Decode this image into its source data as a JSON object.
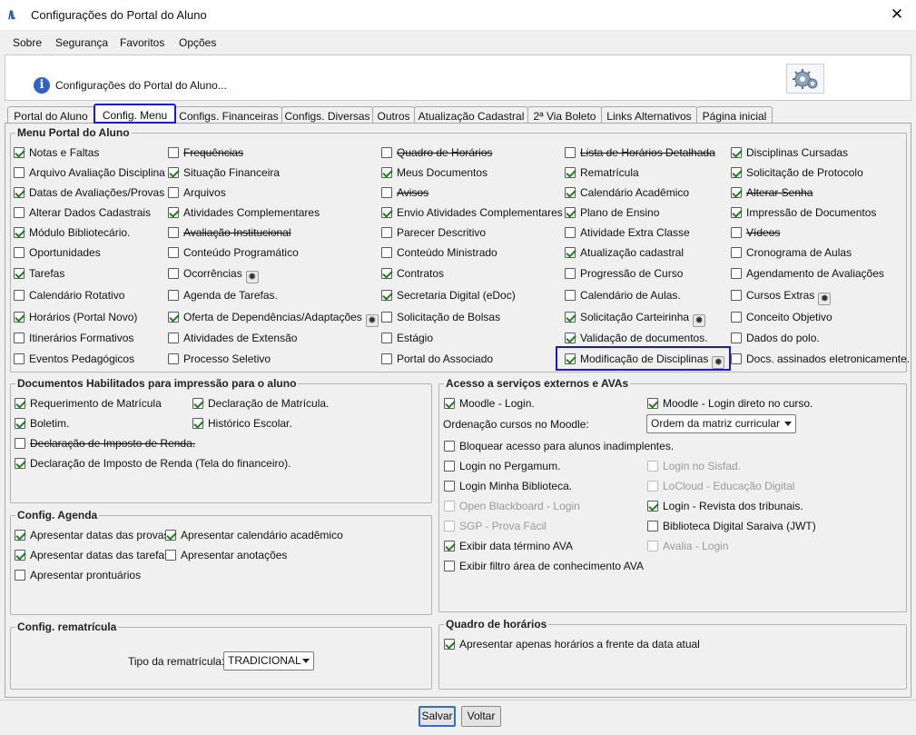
{
  "window": {
    "logo": "/\\\\.",
    "title": "Configurações do Portal do Aluno",
    "close": "✕"
  },
  "menubar": {
    "sobre": "Sobre",
    "seguranca": "Segurança",
    "favoritos": "Favoritos",
    "opcoes": "Opções"
  },
  "header": {
    "info_icon": "i",
    "text": "Configurações do Portal do Aluno...",
    "settings_icon": "gears-icon"
  },
  "tabs": [
    "Portal do Aluno",
    "Config. Menu",
    "Configs. Financeiras",
    "Configs. Diversas",
    "Outros",
    "Atualização Cadastral",
    "2ª Via Boleto",
    "Links Alternativos",
    "Página inicial"
  ],
  "active_tab": "Config. Menu",
  "menu_portal": {
    "title": "Menu Portal do Aluno",
    "columns": [
      [
        {
          "label": "Notas e Faltas",
          "checked": true
        },
        {
          "label": "Arquivo Avaliação Disciplina",
          "checked": false
        },
        {
          "label": "Datas de Avaliações/Provas",
          "checked": true
        },
        {
          "label": "Alterar Dados Cadastrais",
          "checked": false
        },
        {
          "label": "Módulo Bibliotecário.",
          "checked": true
        },
        {
          "label": "Oportunidades",
          "checked": false
        },
        {
          "label": "Tarefas",
          "checked": true
        },
        {
          "label": "Calendário Rotativo",
          "checked": false
        },
        {
          "label": "Horários (Portal Novo)",
          "checked": true
        },
        {
          "label": "Itinerários Formativos",
          "checked": false
        },
        {
          "label": "Eventos Pedagógicos",
          "checked": false
        }
      ],
      [
        {
          "label": "Frequências",
          "checked": false,
          "strike": true
        },
        {
          "label": "Situação Financeira",
          "checked": true
        },
        {
          "label": "Arquivos",
          "checked": false
        },
        {
          "label": "Atividades Complementares",
          "checked": true
        },
        {
          "label": "Avaliação Institucional",
          "checked": false,
          "strike": true
        },
        {
          "label": "Conteúdo Programático",
          "checked": false
        },
        {
          "label": "Ocorrências",
          "checked": false,
          "gear": true
        },
        {
          "label": "Agenda de Tarefas.",
          "checked": false
        },
        {
          "label": "Oferta de Dependências/Adaptações",
          "checked": true,
          "gear": true
        },
        {
          "label": "Atividades de Extensão",
          "checked": false
        },
        {
          "label": "Processo Seletivo",
          "checked": false
        }
      ],
      [
        {
          "label": "Quadro de Horários",
          "checked": false,
          "strike": true
        },
        {
          "label": "Meus Documentos",
          "checked": true
        },
        {
          "label": "Avisos",
          "checked": false,
          "strike": true
        },
        {
          "label": "Envio Atividades Complementares",
          "checked": true
        },
        {
          "label": "Parecer Descritivo",
          "checked": false
        },
        {
          "label": "Conteúdo Ministrado",
          "checked": false
        },
        {
          "label": "Contratos",
          "checked": true
        },
        {
          "label": "Secretaria Digital (eDoc)",
          "checked": true
        },
        {
          "label": "Solicitação de Bolsas",
          "checked": false
        },
        {
          "label": "Estágio",
          "checked": false
        },
        {
          "label": "Portal do Associado",
          "checked": false
        }
      ],
      [
        {
          "label": "Lista de Horários Detalhada",
          "checked": false,
          "strike": true
        },
        {
          "label": "Rematrícula",
          "checked": true
        },
        {
          "label": "Calendário Acadêmico",
          "checked": true
        },
        {
          "label": "Plano de Ensino",
          "checked": true
        },
        {
          "label": "Atividade Extra Classe",
          "checked": false
        },
        {
          "label": "Atualização cadastral",
          "checked": true
        },
        {
          "label": "Progressão de Curso",
          "checked": false
        },
        {
          "label": "Calendário de Aulas.",
          "checked": false
        },
        {
          "label": "Solicitação Carteirinha",
          "checked": true,
          "gear": true
        },
        {
          "label": "Validação de documentos.",
          "checked": true
        },
        {
          "label": "Modificação de Disciplinas",
          "checked": true,
          "gear": true
        }
      ],
      [
        {
          "label": "Disciplinas Cursadas",
          "checked": true
        },
        {
          "label": "Solicitação de Protocolo",
          "checked": true
        },
        {
          "label": "Alterar Senha",
          "checked": true,
          "strike": true
        },
        {
          "label": "Impressão de Documentos",
          "checked": true
        },
        {
          "label": "Vídeos",
          "checked": false,
          "strike": true
        },
        {
          "label": "Cronograma de Aulas",
          "checked": false
        },
        {
          "label": "Agendamento de Avaliações",
          "checked": false
        },
        {
          "label": "Cursos Extras",
          "checked": false,
          "gear": true
        },
        {
          "label": "Conceito Objetivo",
          "checked": false
        },
        {
          "label": "Dados do polo.",
          "checked": false
        },
        {
          "label": "Docs. assinados eletronicamente.",
          "checked": false
        }
      ]
    ]
  },
  "docs": {
    "title": "Documentos Habilitados para impressão para o aluno",
    "items": [
      {
        "label": "Requerimento de Matrícula",
        "checked": true
      },
      {
        "label": "Declaração de Matrícula.",
        "checked": true
      },
      {
        "label": "Boletim.",
        "checked": true
      },
      {
        "label": "Histórico Escolar.",
        "checked": true
      },
      {
        "label": "Declaração de Imposto de Renda.",
        "checked": false,
        "strike": true
      },
      {
        "label": "Declaração de Imposto de Renda (Tela do financeiro).",
        "checked": true
      }
    ]
  },
  "agenda": {
    "title": "Config. Agenda",
    "items": [
      {
        "label": "Apresentar datas das provas",
        "checked": true
      },
      {
        "label": "Apresentar calendário acadêmico",
        "checked": true
      },
      {
        "label": "Apresentar datas das tarefas",
        "checked": true
      },
      {
        "label": "Apresentar anotações",
        "checked": false
      },
      {
        "label": "Apresentar prontuários",
        "checked": false
      }
    ]
  },
  "rematricula": {
    "title": "Config. rematrícula",
    "label": "Tipo da rematrícula:",
    "value": "TRADICIONAL"
  },
  "ava": {
    "title": "Acesso a serviços externos e AVAs",
    "moodle_login": {
      "label": "Moodle - Login.",
      "checked": true
    },
    "moodle_direct": {
      "label": "Moodle - Login direto no curso.",
      "checked": true
    },
    "ordenacao_label": "Ordenação cursos no Moodle:",
    "ordenacao_value": "Ordem da matriz curricular",
    "items": [
      {
        "label": "Bloquear acesso para alunos inadimplentes.",
        "checked": false
      },
      {
        "label": "Login no Pergamum.",
        "checked": false
      },
      {
        "label": "Login no Sisfad.",
        "checked": false,
        "disabled": true
      },
      {
        "label": "Login Minha Biblioteca.",
        "checked": false
      },
      {
        "label": "LoCloud - Educação Digital",
        "checked": false,
        "disabled": true
      },
      {
        "label": "Open Blackboard - Login",
        "checked": false,
        "disabled": true
      },
      {
        "label": "Login - Revista dos tribunais.",
        "checked": true
      },
      {
        "label": "SGP - Prova Fácil",
        "checked": false,
        "disabled": true
      },
      {
        "label": "Biblioteca Digital Saraiva (JWT)",
        "checked": false
      },
      {
        "label": "Exibir data término AVA",
        "checked": true
      },
      {
        "label": "Avalia - Login",
        "checked": false,
        "disabled": true
      },
      {
        "label": "Exibir filtro área de conhecimento AVA",
        "checked": false
      }
    ]
  },
  "quadro": {
    "title": "Quadro de horários",
    "item": {
      "label": "Apresentar apenas horários a frente da data atual",
      "checked": true
    }
  },
  "buttons": {
    "salvar": "Salvar",
    "voltar": "Voltar"
  },
  "colors": {
    "highlight": "#1a16d8",
    "check": "#1b7f1b",
    "info": "#2f62c9"
  }
}
